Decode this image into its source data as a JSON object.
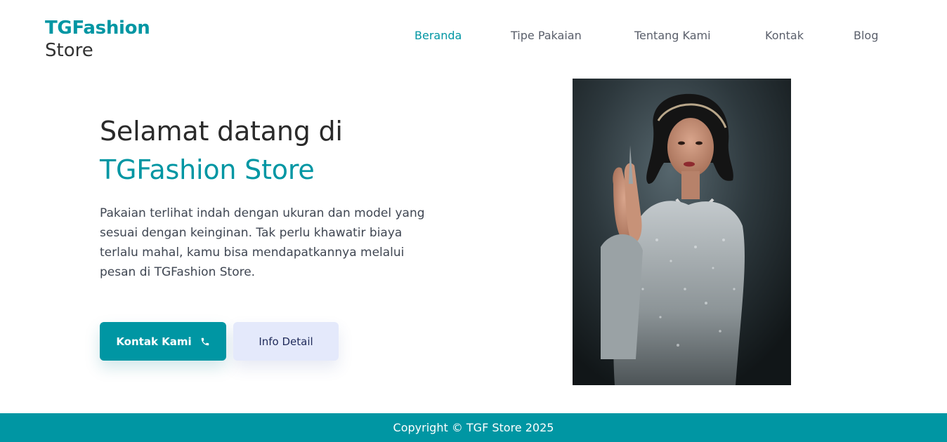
{
  "brand": {
    "name": "TGFashion",
    "sub": "Store"
  },
  "nav": {
    "items": [
      {
        "label": "Beranda",
        "active": true
      },
      {
        "label": "Tipe Pakaian",
        "active": false
      },
      {
        "label": "Tentang Kami",
        "active": false
      },
      {
        "label": "Kontak",
        "active": false
      },
      {
        "label": "Blog",
        "active": false
      }
    ]
  },
  "hero": {
    "title_line1": "Selamat datang di",
    "title_line2": "TGFashion Store",
    "description": "Pakaian terlihat indah dengan ukuran dan model yang sesuai dengan keinginan. Tak perlu khawatir biaya terlalu mahal, kamu bisa mendapatkannya melalui pesan di TGFashion Store.",
    "primary_button": "Kontak Kami",
    "primary_button_icon": "phone-icon",
    "secondary_button": "Info Detail"
  },
  "footer": {
    "text": "Copyright © TGF Store 2025"
  },
  "colors": {
    "accent": "#0096a3",
    "secondary_button_bg": "#e4e9fb"
  }
}
